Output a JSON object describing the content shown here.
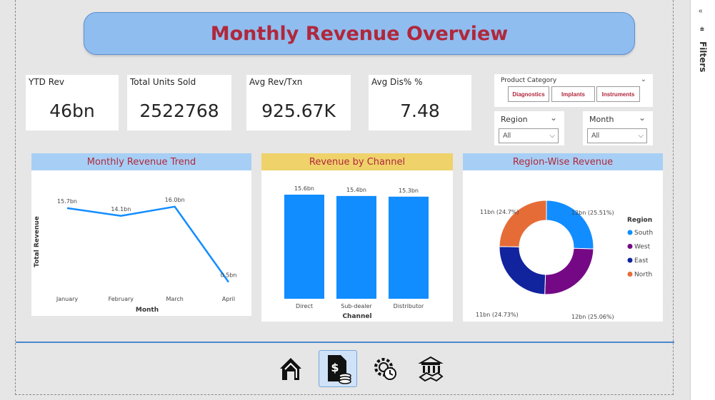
{
  "title": "Monthly Revenue Overview",
  "kpis": [
    {
      "label": "YTD Rev",
      "value": "46bn"
    },
    {
      "label": "Total Units Sold",
      "value": "2522768"
    },
    {
      "label": "Avg Rev/Txn",
      "value": "925.67K"
    },
    {
      "label": "Avg Dis% %",
      "value": "7.48"
    }
  ],
  "product_category": {
    "label": "Product Category",
    "options": [
      "Diagnostics",
      "Implants",
      "Instruments"
    ]
  },
  "region_filter": {
    "label": "Region",
    "value": "All"
  },
  "month_filter": {
    "label": "Month",
    "value": "All"
  },
  "filters_pane": {
    "label": "Filters"
  },
  "colors": {
    "accent": "#8fbdf0",
    "title": "#b0283c",
    "bar": "#118dff",
    "south": "#118dff",
    "west": "#750985",
    "east": "#12239e",
    "north": "#e66c37"
  },
  "nav_icons": [
    "home-icon",
    "revenue-icon",
    "operations-icon",
    "partners-icon"
  ],
  "chart_data": [
    {
      "type": "line",
      "title": "Monthly Revenue Trend",
      "xlabel": "Month",
      "ylabel": "Total Revenue",
      "categories": [
        "January",
        "February",
        "March",
        "April"
      ],
      "values": [
        15.7,
        14.1,
        16.0,
        0.5
      ],
      "labels": [
        "15.7bn",
        "14.1bn",
        "16.0bn",
        "0.5bn"
      ],
      "grid": false
    },
    {
      "type": "bar",
      "title": "Revenue by Channel",
      "xlabel": "Channel",
      "ylabel": "",
      "categories": [
        "Direct",
        "Sub-dealer",
        "Distributor"
      ],
      "values": [
        15.6,
        15.4,
        15.3
      ],
      "labels": [
        "15.6bn",
        "15.4bn",
        "15.3bn"
      ],
      "grid": false
    },
    {
      "type": "pie",
      "title": "Region-Wise Revenue",
      "legend_title": "Region",
      "legend_position": "right",
      "slices": [
        {
          "name": "South",
          "value": 25.51,
          "label": "12bn (25.51%)"
        },
        {
          "name": "West",
          "value": 25.06,
          "label": "12bn (25.06%)"
        },
        {
          "name": "East",
          "value": 24.73,
          "label": "11bn (24.73%)"
        },
        {
          "name": "North",
          "value": 24.7,
          "label": "11bn (24.7%)"
        }
      ]
    }
  ]
}
